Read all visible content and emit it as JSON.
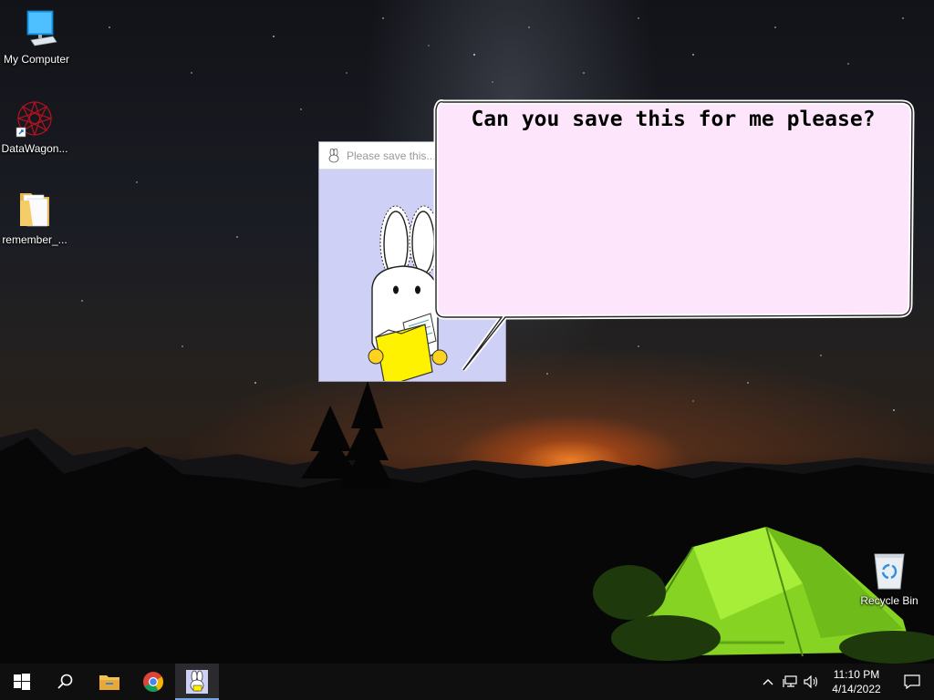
{
  "desktop": {
    "icons": [
      {
        "label": "My Computer",
        "icon": "computer-icon"
      },
      {
        "label": "DataWagon...",
        "icon": "datawagon-shortcut-icon"
      },
      {
        "label": "remember_...",
        "icon": "folder-icon"
      },
      {
        "label": "Recycle Bin",
        "icon": "recycle-bin-icon"
      }
    ]
  },
  "helper": {
    "title": "Please save this...",
    "bubble_text": "Can you save this for me please?",
    "mascot": "bunny-holding-folder"
  },
  "taskbar": {
    "items": [
      "start-icon",
      "search-icon",
      "file-explorer-icon",
      "chrome-icon",
      "bunny-app-icon"
    ],
    "active_item": "bunny-app-icon",
    "clock_time": "11:10 PM",
    "clock_date": "4/14/2022"
  },
  "colors": {
    "bubble_fill": "#fde5fb",
    "window_bg": "#cfd0f5",
    "folder_yellow": "#fff200",
    "tent_green": "#8ee025"
  }
}
